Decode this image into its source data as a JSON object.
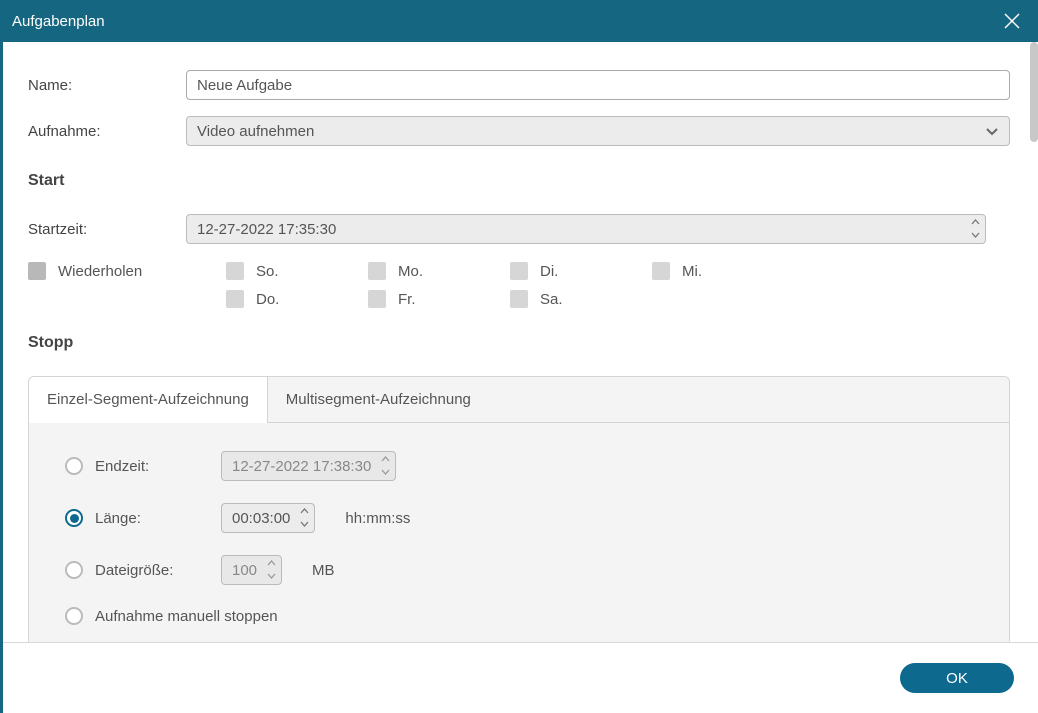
{
  "titlebar": {
    "title": "Aufgabenplan"
  },
  "form": {
    "name_label": "Name:",
    "name_value": "Neue Aufgabe",
    "aufnahme_label": "Aufnahme:",
    "aufnahme_value": "Video aufnehmen"
  },
  "start": {
    "heading": "Start",
    "startzeit_label": "Startzeit:",
    "startzeit_value": "12-27-2022 17:35:30",
    "repeat_label": "Wiederholen",
    "days": [
      "So.",
      "Mo.",
      "Di.",
      "Mi.",
      "Do.",
      "Fr.",
      "Sa."
    ]
  },
  "stopp": {
    "heading": "Stopp",
    "tabs": [
      {
        "label": "Einzel-Segment-Aufzeichnung",
        "active": true
      },
      {
        "label": "Multisegment-Aufzeichnung",
        "active": false
      }
    ],
    "options": {
      "endzeit": {
        "label": "Endzeit:",
        "value": "12-27-2022 17:38:30",
        "selected": false
      },
      "laenge": {
        "label": "Länge:",
        "value": "00:03:00",
        "unit": "hh:mm:ss",
        "selected": true
      },
      "dateigroesse": {
        "label": "Dateigröße:",
        "value": "100",
        "unit": "MB",
        "selected": false
      },
      "manuell": {
        "label": "Aufnahme manuell stoppen",
        "selected": false
      }
    }
  },
  "footer": {
    "ok_label": "OK"
  }
}
